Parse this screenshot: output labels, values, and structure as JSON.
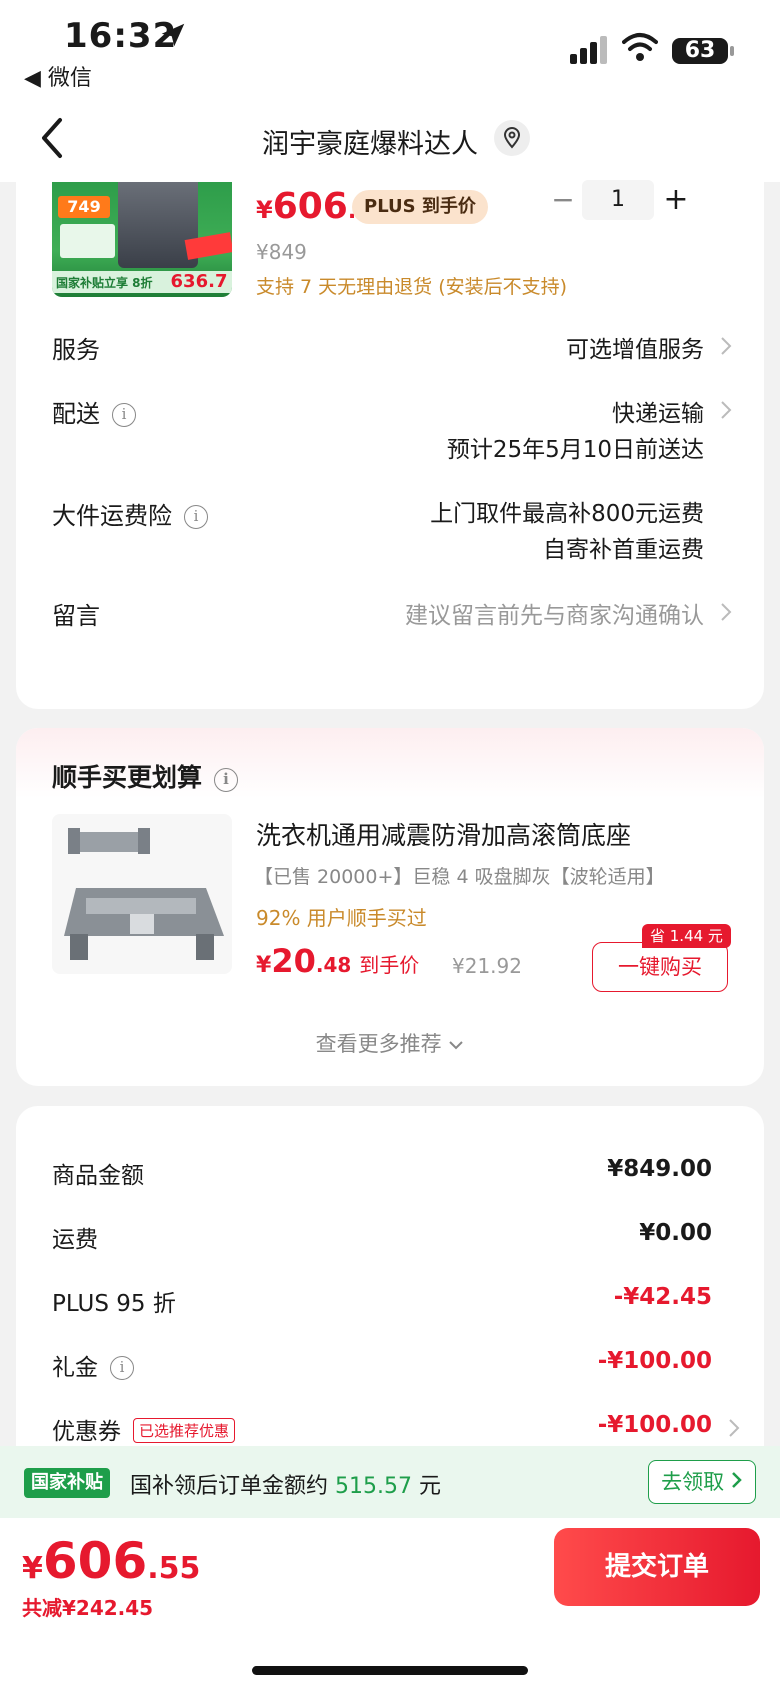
{
  "status_bar": {
    "time": "16:32",
    "back_app": "◀ 微信",
    "battery": "63"
  },
  "nav": {
    "title": "润宇豪庭爆料达人"
  },
  "product": {
    "thumb_price_tag": "749",
    "thumb_bottom_text": "国家补贴立享 8折",
    "thumb_bottom_price": "636.7",
    "price_yen": "¥",
    "price_int": "606",
    "price_dec": ".55",
    "plus_tag": "PLUS 到手价",
    "original_price": "¥849",
    "quantity": "1",
    "return_note": "支持 7 天无理由退货 (安装后不支持)"
  },
  "rows": {
    "service": {
      "label": "服务",
      "value": "可选增值服务"
    },
    "delivery": {
      "label": "配送",
      "value": "快递运输",
      "sub": "预计25年5月10日前送达"
    },
    "insurance": {
      "label": "大件运费险",
      "value": "上门取件最高补800元运费",
      "sub": "自寄补首重运费"
    },
    "message": {
      "label": "留言",
      "placeholder": "建议留言前先与商家沟通确认"
    }
  },
  "recommend": {
    "title": "顺手买更划算",
    "name": "洗衣机通用减震防滑加高滚筒底座",
    "spec": "【已售 20000+】巨稳 4 吸盘脚灰【波轮适用】",
    "bought": "92% 用户顺手买过",
    "price_yen": "¥",
    "price_int": "20",
    "price_dec": ".48",
    "price_label": "到手价",
    "original_price": "¥21.92",
    "save_badge": "省 1.44 元",
    "buy_button": "一键购买",
    "more": "查看更多推荐"
  },
  "summary": {
    "items": [
      {
        "label": "商品金额",
        "value": "¥849.00",
        "red": false
      },
      {
        "label": "运费",
        "value": "¥0.00",
        "red": false
      },
      {
        "label": "PLUS 95 折",
        "value": "-¥42.45",
        "red": true
      },
      {
        "label": "礼金",
        "value": "-¥100.00",
        "red": true
      },
      {
        "label": "优惠券",
        "value": "-¥100.00",
        "red": true
      }
    ],
    "coupon_tag": "已选推荐优惠"
  },
  "subsidy": {
    "tag": "国家补贴",
    "text_before": "国补领后订单金额约 ",
    "amount": "515.57",
    "text_after": " 元",
    "button": "去领取"
  },
  "footer": {
    "total_yen": "¥",
    "total_int": "606",
    "total_dec": ".55",
    "saved": "共减¥242.45",
    "submit": "提交订单"
  },
  "colors": {
    "accent_red": "#e6192e",
    "subsidy_green": "#1e9e4a",
    "gold": "#c98a2b"
  },
  "icons": [
    "location-arrow-icon",
    "signal-icon",
    "wifi-icon",
    "back-chevron-icon",
    "location-pin-icon",
    "info-icon",
    "chevron-right-icon",
    "chevron-down-icon"
  ]
}
